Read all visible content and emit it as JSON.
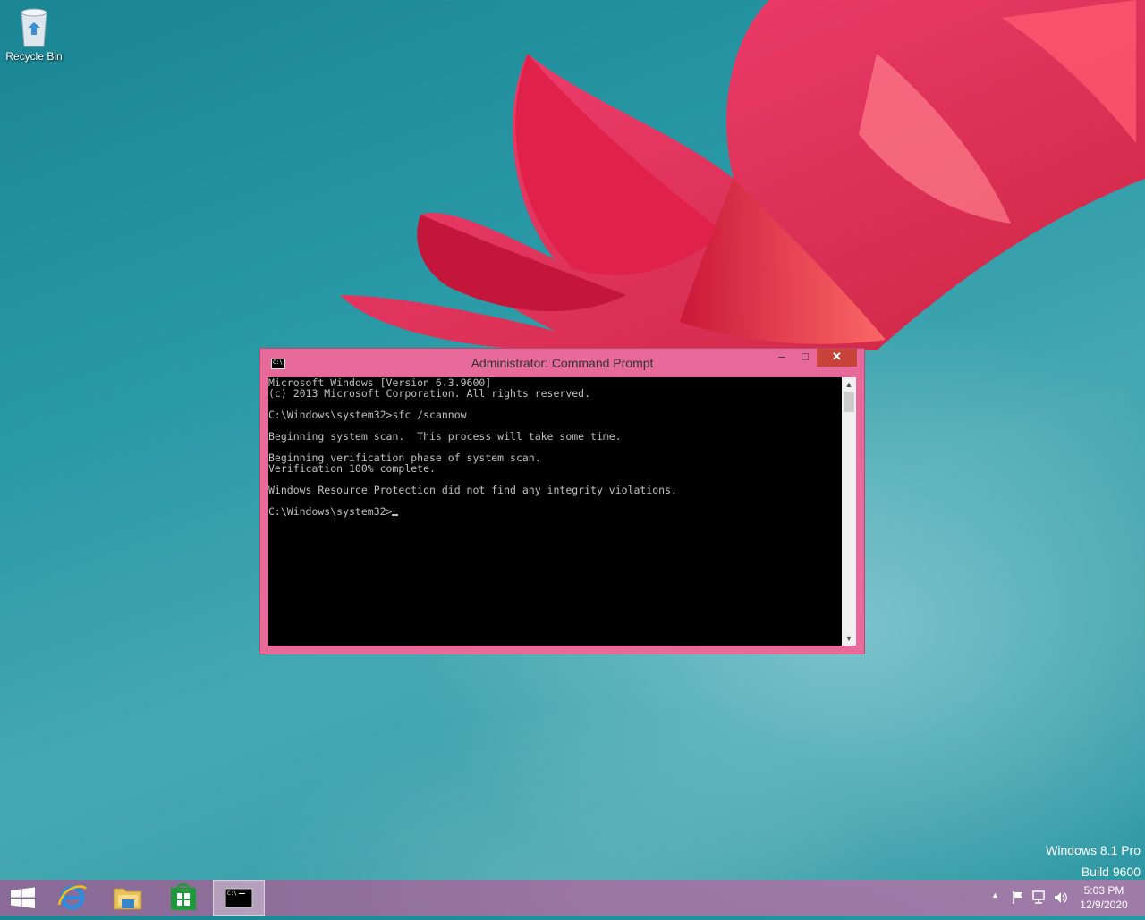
{
  "desktop": {
    "icons": [
      {
        "label": "Recycle Bin",
        "icon": "recycle-bin-icon"
      }
    ],
    "watermark": {
      "line1": "Windows 8.1 Pro",
      "line2": "Build 9600"
    }
  },
  "window": {
    "title": "Administrator: Command Prompt",
    "icon": "command-prompt-icon",
    "controls": {
      "minimize": "–",
      "maximize": "□",
      "close": "✕"
    },
    "console_lines": [
      "Microsoft Windows [Version 6.3.9600]",
      "(c) 2013 Microsoft Corporation. All rights reserved.",
      "",
      "C:\\Windows\\system32>sfc /scannow",
      "",
      "Beginning system scan.  This process will take some time.",
      "",
      "Beginning verification phase of system scan.",
      "Verification 100% complete.",
      "",
      "Windows Resource Protection did not find any integrity violations.",
      "",
      "C:\\Windows\\system32>"
    ]
  },
  "taskbar": {
    "items": [
      {
        "name": "start-button",
        "icon": "windows-logo-icon"
      },
      {
        "name": "internet-explorer",
        "icon": "internet-explorer-icon"
      },
      {
        "name": "file-explorer",
        "icon": "folder-icon"
      },
      {
        "name": "store",
        "icon": "store-icon"
      },
      {
        "name": "command-prompt",
        "icon": "command-prompt-icon",
        "active": true
      }
    ],
    "tray_icons": [
      "show-hidden-icons-icon",
      "action-center-flag-icon",
      "network-icon",
      "volume-icon"
    ],
    "clock": {
      "time": "5:03 PM",
      "date": "12/9/2020"
    }
  }
}
